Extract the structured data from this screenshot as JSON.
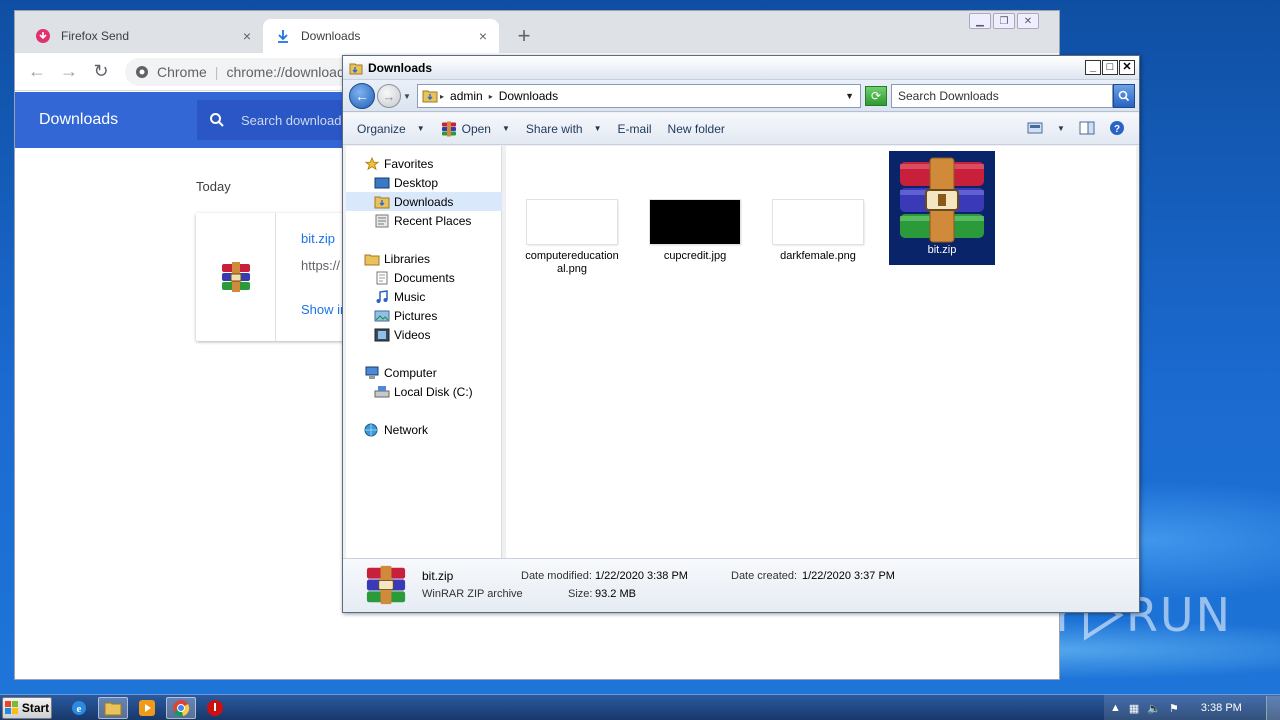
{
  "chrome": {
    "tabs": [
      {
        "label": "Firefox Send",
        "icon": "firefox-send-icon",
        "close": "×"
      },
      {
        "label": "Downloads",
        "icon": "download-arrow-icon",
        "close": "×"
      }
    ],
    "new_tab": "+",
    "omnibox": {
      "site": "Chrome",
      "url": "chrome://downloads"
    },
    "downloads_page": {
      "title": "Downloads",
      "search_placeholder": "Search downloads",
      "section": "Today",
      "item": {
        "filename": "bit.zip",
        "url": "https://",
        "action": "Show in folder"
      }
    }
  },
  "explorer": {
    "title": "Downloads",
    "breadcrumb": [
      "admin",
      "Downloads"
    ],
    "search_placeholder": "Search Downloads",
    "commands": [
      "Organize",
      "Open",
      "Share with",
      "E-mail",
      "New folder"
    ],
    "nav": {
      "favorites": "Favorites",
      "favorite_items": [
        "Desktop",
        "Downloads",
        "Recent Places"
      ],
      "libraries": "Libraries",
      "library_items": [
        "Documents",
        "Music",
        "Pictures",
        "Videos"
      ],
      "computer": "Computer",
      "computer_items": [
        "Local Disk (C:)"
      ],
      "network": "Network"
    },
    "files": [
      {
        "name": "computereducational.png",
        "display": "computereducation al.png"
      },
      {
        "name": "cupcredit.jpg",
        "display": "cupcredit.jpg"
      },
      {
        "name": "darkfemale.png",
        "display": "darkfemale.png"
      },
      {
        "name": "bit.zip",
        "display": "bit.zip",
        "selected": true
      }
    ],
    "details": {
      "name": "bit.zip",
      "type": "WinRAR ZIP archive",
      "date_modified_label": "Date modified:",
      "date_modified": "1/22/2020 3:38 PM",
      "date_created_label": "Date created:",
      "date_created": "1/22/2020 3:37 PM",
      "size_label": "Size:",
      "size": "93.2 MB"
    }
  },
  "taskbar": {
    "start_label": "Start",
    "clock": "3:38 PM"
  },
  "watermark": "ANY RUN"
}
